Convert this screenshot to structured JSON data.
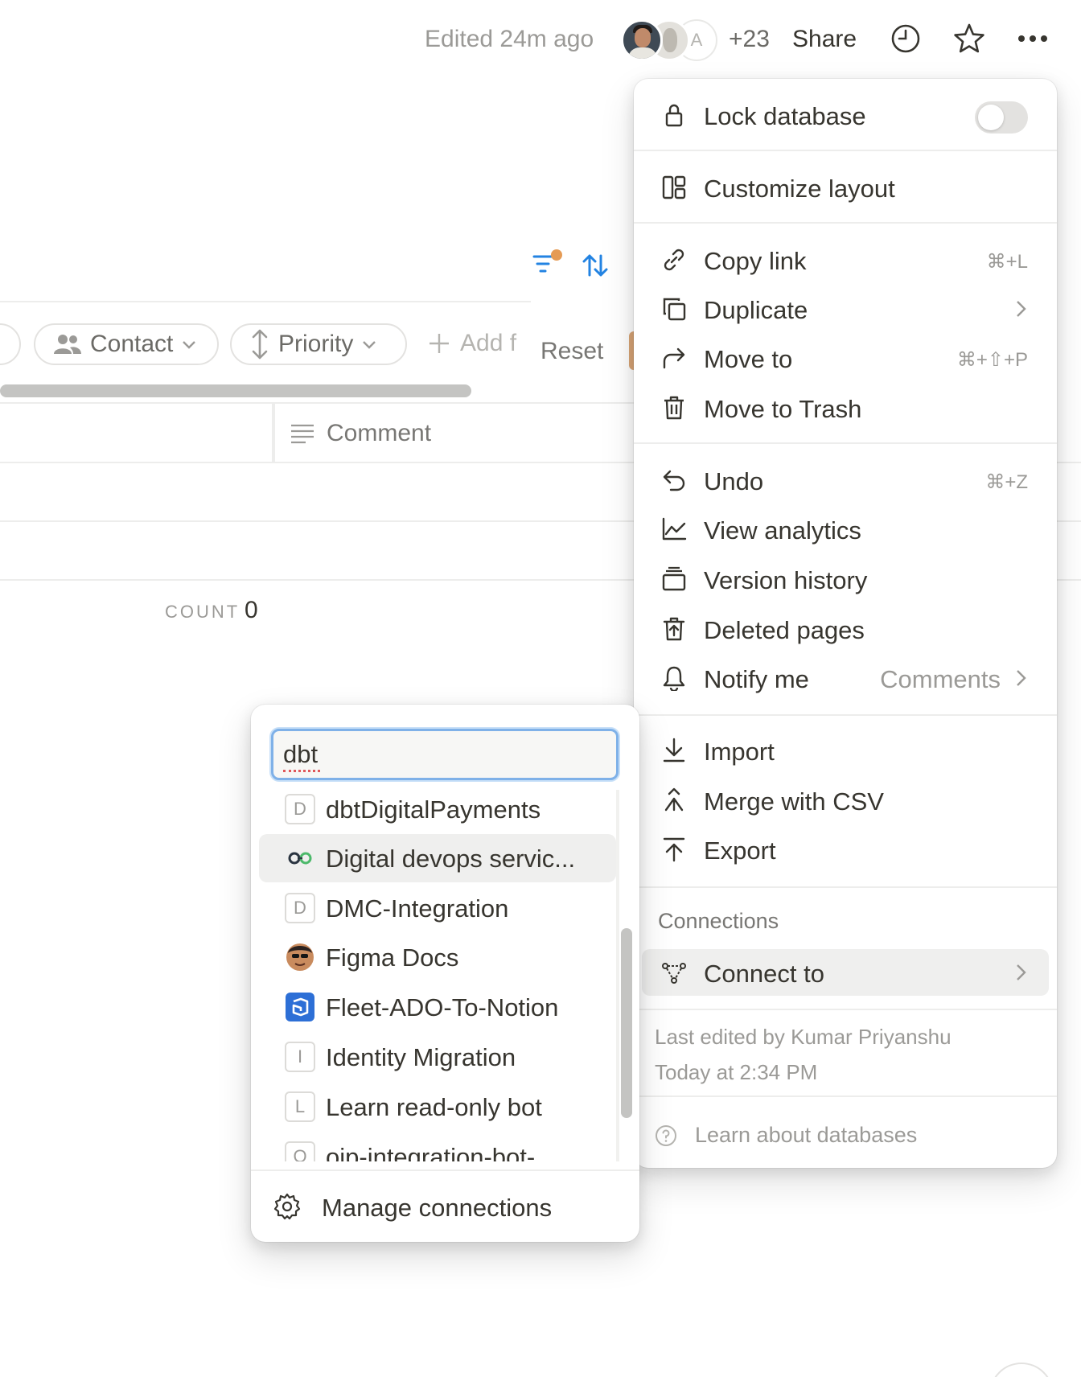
{
  "topbar": {
    "edited": "Edited 24m ago",
    "avatar_letter": "A",
    "extra_count": "+23",
    "share": "Share",
    "icons": [
      "clock-icon",
      "star-icon",
      "more-icon"
    ]
  },
  "database": {
    "chips": [
      {
        "label": "Contact",
        "icon": "people-icon"
      },
      {
        "label": "Priority",
        "icon": "updown-arrows-icon"
      }
    ],
    "add_filter": "Add f",
    "reset": "Reset",
    "comment_column": "Comment",
    "count_label": "COUNT",
    "count_value": "0",
    "filter_dot_color": "#e59b55",
    "accent_color": "#2383e2"
  },
  "menu": {
    "lock_database": "Lock database",
    "lock_enabled": false,
    "customize_layout": "Customize layout",
    "copy_link": "Copy link",
    "copy_link_shortcut": "⌘+L",
    "duplicate": "Duplicate",
    "move_to": "Move to",
    "move_to_shortcut": "⌘+⇧+P",
    "move_to_trash": "Move to Trash",
    "undo": "Undo",
    "undo_shortcut": "⌘+Z",
    "view_analytics": "View analytics",
    "version_history": "Version history",
    "deleted_pages": "Deleted pages",
    "notify_me": "Notify me",
    "notify_value": "Comments",
    "import": "Import",
    "merge_csv": "Merge with CSV",
    "export": "Export",
    "connections_header": "Connections",
    "connect_to": "Connect to",
    "last_edited_by": "Last edited by Kumar Priyanshu",
    "last_edited_time": "Today at 2:34 PM",
    "learn": "Learn about databases"
  },
  "connect_popup": {
    "search_value": "dbt",
    "items": [
      {
        "label": "dbtDigitalPayments",
        "badge": "D"
      },
      {
        "label": "Digital devops servic...",
        "icon": "link-icon"
      },
      {
        "label": "DMC-Integration",
        "badge": "D"
      },
      {
        "label": "Figma Docs",
        "icon": "face-avatar-icon"
      },
      {
        "label": "Fleet-ADO-To-Notion",
        "icon": "azure-devops-icon"
      },
      {
        "label": "Identity Migration",
        "badge": "I"
      },
      {
        "label": "Learn read-only bot",
        "badge": "L"
      },
      {
        "label": "oip-integration-bot-",
        "badge": "O"
      }
    ],
    "manage": "Manage connections"
  }
}
